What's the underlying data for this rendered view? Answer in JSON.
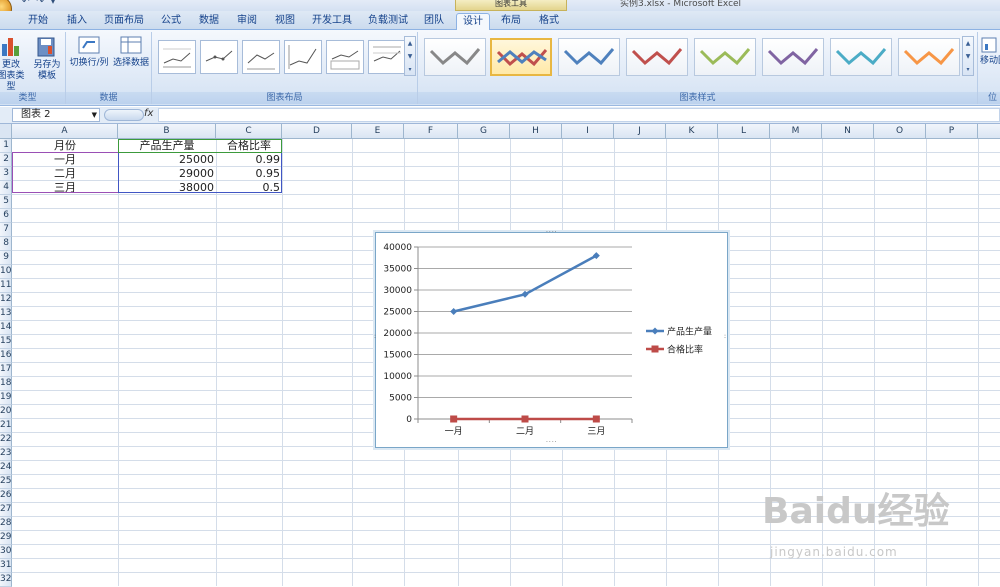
{
  "window": {
    "title": "实例3.xlsx - Microsoft Excel",
    "context_tab_group": "图表工具"
  },
  "tabs": [
    "开始",
    "插入",
    "页面布局",
    "公式",
    "数据",
    "审阅",
    "视图",
    "开发工具",
    "负载测试",
    "团队",
    "设计",
    "布局",
    "格式"
  ],
  "active_tab": "设计",
  "ribbon": {
    "groups": {
      "type": "类型",
      "data": "数据",
      "layouts": "图表布局",
      "styles": "图表样式",
      "location": "位"
    },
    "buttons": {
      "change_type_line1": "更改",
      "change_type_line2": "图表类型",
      "save_template_line1": "另存为",
      "save_template_line2": "模板",
      "switch_row_col": "切换行/列",
      "select_data": "选择数据",
      "move_chart": "移动图"
    }
  },
  "formula_bar": {
    "name_box": "图表 2",
    "fx": "fx",
    "formula": ""
  },
  "columns": [
    "A",
    "B",
    "C",
    "D",
    "E",
    "F",
    "G",
    "H",
    "I",
    "J",
    "K",
    "L",
    "M",
    "N",
    "O",
    "P"
  ],
  "rows": [
    "1",
    "2",
    "3",
    "4",
    "5",
    "6",
    "7",
    "8",
    "9",
    "10",
    "11",
    "12",
    "13",
    "14",
    "15",
    "16",
    "17",
    "18",
    "19",
    "20",
    "21",
    "22",
    "23",
    "24",
    "25",
    "26",
    "27",
    "28",
    "29",
    "30",
    "31",
    "32"
  ],
  "cells": {
    "A1": "月份",
    "B1": "产品生产量",
    "C1": "合格比率",
    "A2": "一月",
    "B2": "25000",
    "C2": "0.99",
    "A3": "二月",
    "B3": "29000",
    "C3": "0.95",
    "A4": "三月",
    "B4": "38000",
    "C4": "0.5"
  },
  "chart_data": {
    "type": "line",
    "categories": [
      "一月",
      "二月",
      "三月"
    ],
    "series": [
      {
        "name": "产品生产量",
        "values": [
          25000,
          29000,
          38000
        ],
        "color": "#4a7ebb"
      },
      {
        "name": "合格比率",
        "values": [
          0.99,
          0.95,
          0.5
        ],
        "color": "#be4b48"
      }
    ],
    "yticks": [
      "0",
      "5000",
      "10000",
      "15000",
      "20000",
      "25000",
      "30000",
      "35000",
      "40000"
    ],
    "ylim": [
      0,
      40000
    ],
    "grid": true,
    "legend_position": "right",
    "title": "",
    "xlabel": "",
    "ylabel": ""
  },
  "watermark": {
    "logo": "Baidu经验",
    "url": "jingyan.baidu.com"
  }
}
